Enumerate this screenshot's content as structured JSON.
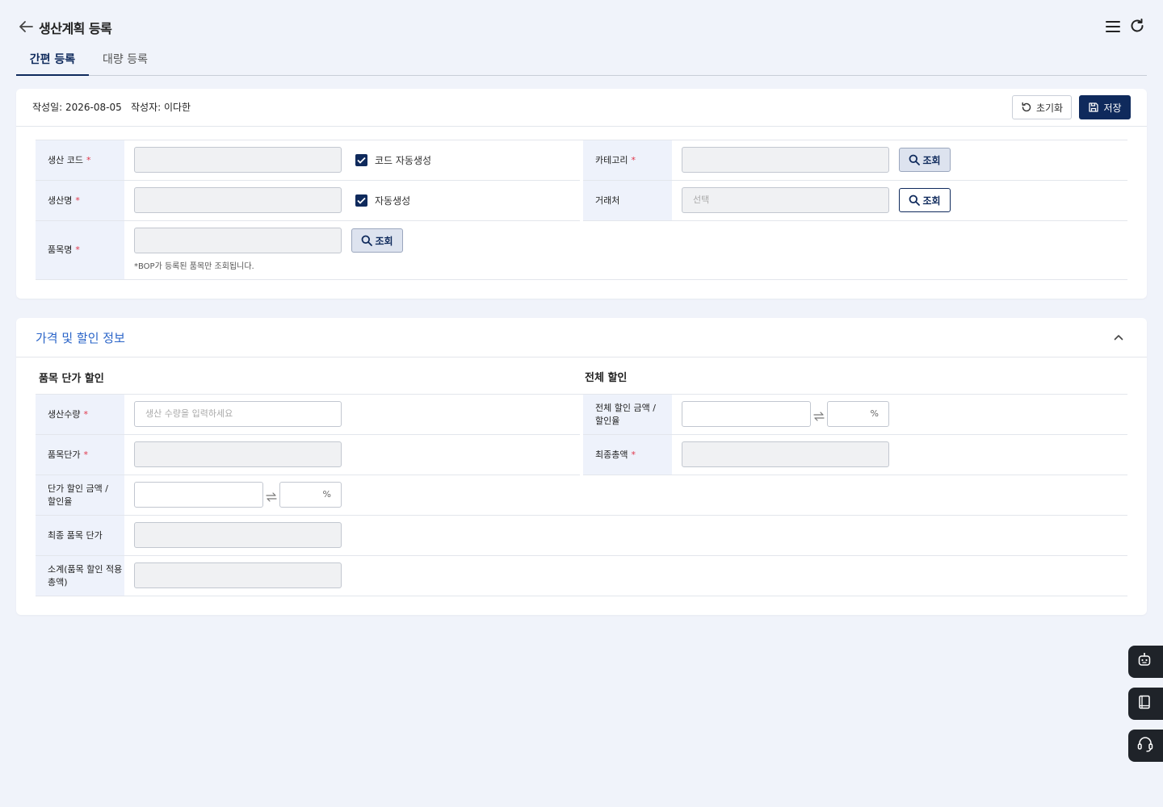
{
  "header": {
    "title": "생산계획 등록"
  },
  "tabs": [
    {
      "label": "간편 등록",
      "active": true
    },
    {
      "label": "대량 등록",
      "active": false
    }
  ],
  "meta": {
    "date": "작성일: 2026-08-05",
    "author": "작성자: 이다한"
  },
  "actions": {
    "reset_label": "초기화",
    "save_label": "저장"
  },
  "form": {
    "production_code": {
      "label": "생산 코드",
      "value": ""
    },
    "auto_code": {
      "label": "코드 자동생성",
      "checked": true
    },
    "category": {
      "label": "카테고리",
      "value": "",
      "search_label": "조회"
    },
    "production_name": {
      "label": "생산명",
      "value": ""
    },
    "auto_name": {
      "label": "자동생성",
      "checked": true
    },
    "client": {
      "label": "거래처",
      "placeholder": "선택",
      "search_label": "조회"
    },
    "item_name": {
      "label": "품목명",
      "value": "",
      "search_label": "조회",
      "hint": "*BOP가 등록된 품목만 조회됩니다."
    }
  },
  "price_section": {
    "title": "가격 및 할인 정보",
    "item_discount": {
      "title": "품목 단가 할인",
      "quantity": {
        "label": "생산수량",
        "placeholder": "생산 수량을 입력하세요"
      },
      "unit_price": {
        "label": "품목단가"
      },
      "unit_discount": {
        "label_line1": "단가 할인 금액 /",
        "label_line2": "할인율",
        "percent": "%"
      },
      "final_unit_price": {
        "label": "최종 품목 단가"
      },
      "subtotal": {
        "label_line1": "소계(품목 할인 적용",
        "label_line2": "총액)"
      }
    },
    "total_discount": {
      "title": "전체 할인",
      "amount": {
        "label_line1": "전체 할인 금액 /",
        "label_line2": "할인율",
        "percent": "%"
      },
      "final_total": {
        "label": "최종총액"
      }
    }
  },
  "colors": {
    "primary": "#0f2a5c",
    "accent": "#2a64c8",
    "required": "#e0364a",
    "label_bg": "#eef2fb",
    "page_bg": "#f0f3fa"
  },
  "floating": [
    {
      "icon": "robot-icon"
    },
    {
      "icon": "book-icon"
    },
    {
      "icon": "headset-icon"
    }
  ]
}
